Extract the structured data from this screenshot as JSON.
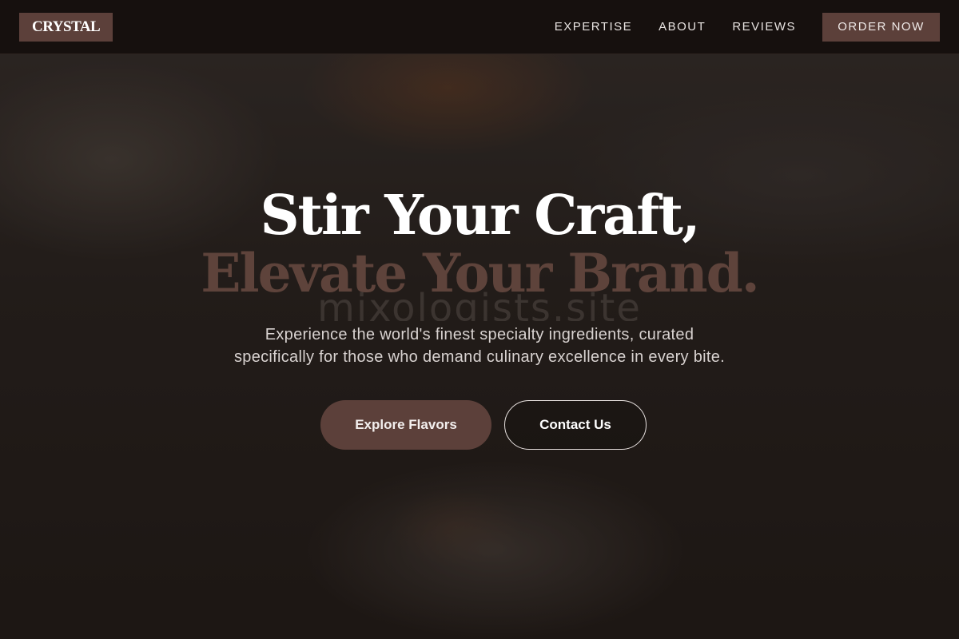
{
  "nav": {
    "logo": "CRYSTAL",
    "links": [
      "EXPERTISE",
      "ABOUT",
      "REVIEWS"
    ],
    "order_label": "ORDER NOW"
  },
  "hero": {
    "headline_line1": "Stir Your Craft,",
    "headline_line2": "Elevate Your Brand.",
    "watermark": "mixologists.site",
    "subtitle_line1": "Experience the world's finest specialty ingredients, curated",
    "subtitle_line2": "specifically for those who demand culinary excellence in every bite.",
    "primary_cta": "Explore Flavors",
    "secondary_cta": "Contact Us"
  },
  "colors": {
    "brand": "#5c403a",
    "nav_background": "#16100e",
    "headline_accent": "#5e433b"
  }
}
